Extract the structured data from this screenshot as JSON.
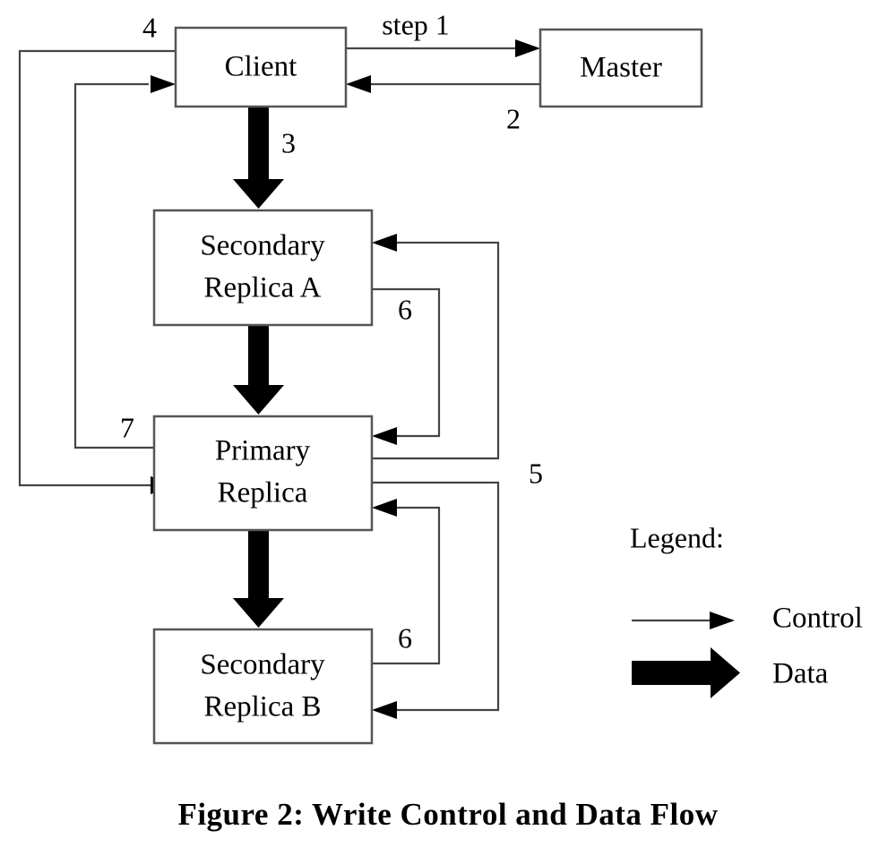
{
  "figure": {
    "caption": "Figure 2: Write Control and Data Flow"
  },
  "nodes": {
    "client": {
      "label": "Client"
    },
    "master": {
      "label": "Master"
    },
    "secondary_a": {
      "line1": "Secondary",
      "line2": "Replica A"
    },
    "primary": {
      "line1": "Primary",
      "line2": "Replica"
    },
    "secondary_b": {
      "line1": "Secondary",
      "line2": "Replica B"
    }
  },
  "step_labels": {
    "step1": "step 1",
    "step2": "2",
    "step3": "3",
    "step4": "4",
    "step5": "5",
    "step6_upper": "6",
    "step6_lower": "6",
    "step7": "7"
  },
  "legend": {
    "title": "Legend:",
    "control_label": "Control",
    "data_label": "Data"
  },
  "colors": {
    "box_stroke": "#555555",
    "control_line": "#444444",
    "arrow_fill": "#000000",
    "background": "#ffffff",
    "text": "#000000"
  },
  "edges": [
    {
      "id": "client-to-master",
      "from": "client",
      "to": "master",
      "kind": "control",
      "label": "step 1"
    },
    {
      "id": "master-to-client",
      "from": "master",
      "to": "client",
      "kind": "control",
      "label": "2"
    },
    {
      "id": "client-to-secondary-a",
      "from": "client",
      "to": "secondary_a",
      "kind": "data",
      "label": "3"
    },
    {
      "id": "client-to-primary",
      "from": "client",
      "to": "primary",
      "kind": "control",
      "label": "4"
    },
    {
      "id": "primary-to-secondary-a",
      "from": "primary",
      "to": "secondary_a",
      "kind": "control",
      "label": "5"
    },
    {
      "id": "primary-to-secondary-b",
      "from": "primary",
      "to": "secondary_b",
      "kind": "control",
      "label": "5"
    },
    {
      "id": "secondary-a-to-primary",
      "from": "secondary_a",
      "to": "primary",
      "kind": "control",
      "label": "6"
    },
    {
      "id": "secondary-b-to-primary",
      "from": "secondary_b",
      "to": "primary",
      "kind": "control",
      "label": "6"
    },
    {
      "id": "primary-to-client",
      "from": "primary",
      "to": "client",
      "kind": "control",
      "label": "7"
    },
    {
      "id": "secondary-a-to-primary-data",
      "from": "secondary_a",
      "to": "primary",
      "kind": "data",
      "label": ""
    },
    {
      "id": "primary-to-secondary-b-data",
      "from": "primary",
      "to": "secondary_b",
      "kind": "data",
      "label": ""
    }
  ]
}
